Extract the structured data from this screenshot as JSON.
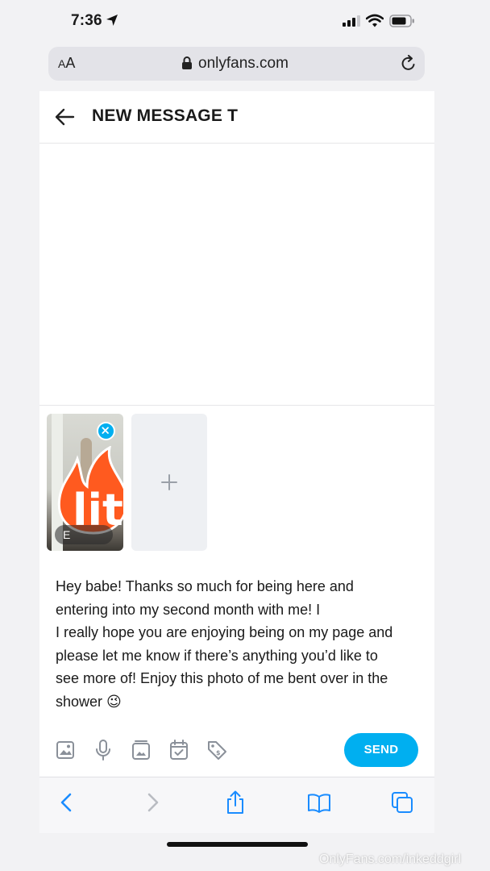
{
  "status_bar": {
    "time": "7:36"
  },
  "url_bar": {
    "aa_large": "A",
    "aa_small": "A",
    "domain": "onlyfans.com"
  },
  "header": {
    "title": "NEW MESSAGE T"
  },
  "media": {
    "edit_label": "E"
  },
  "message": {
    "lines": [
      "Hey babe! Thanks so much for being here and",
      "entering into my second month with me! I",
      "I really hope you are enjoying being on my page and",
      "please let me know if there’s anything you’d like to",
      "see more of! Enjoy this photo of me bent over in the",
      "shower 😉"
    ]
  },
  "toolbar": {
    "send_label": "SEND"
  },
  "sticker": {
    "text": "lit"
  },
  "watermark": "OnlyFans.com/inkeddgirl",
  "colors": {
    "accent": "#00aff0",
    "safari_tint": "#1a8cff"
  }
}
